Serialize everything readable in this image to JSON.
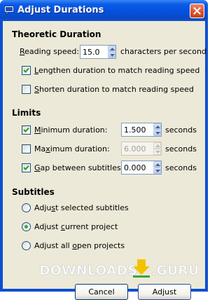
{
  "window": {
    "title": "Adjust Durations"
  },
  "theoretic": {
    "heading": "Theoretic Duration",
    "reading_speed_label": "Reading speed:",
    "reading_speed_value": "15.0",
    "reading_speed_unit": "characters per second",
    "lengthen_label": "Lengthen duration to match reading speed",
    "lengthen_checked": true,
    "shorten_label": "Shorten duration to match reading speed",
    "shorten_checked": false
  },
  "limits": {
    "heading": "Limits",
    "min_label": "Minimum duration:",
    "min_checked": true,
    "min_value": "1.500",
    "max_label": "Maximum duration:",
    "max_checked": false,
    "max_value": "6.000",
    "gap_label": "Gap between subtitles:",
    "gap_checked": true,
    "gap_value": "0.000",
    "unit": "seconds"
  },
  "subtitles": {
    "heading": "Subtitles",
    "options": [
      {
        "label": "Adjust selected subtitles",
        "selected": false
      },
      {
        "label": "Adjust current project",
        "selected": true
      },
      {
        "label": "Adjust all open projects",
        "selected": false
      }
    ]
  },
  "buttons": {
    "cancel": "Cancel",
    "adjust": "Adjust"
  },
  "watermark": {
    "text": "DOWNLOADS",
    "suffix": ".GURU"
  }
}
